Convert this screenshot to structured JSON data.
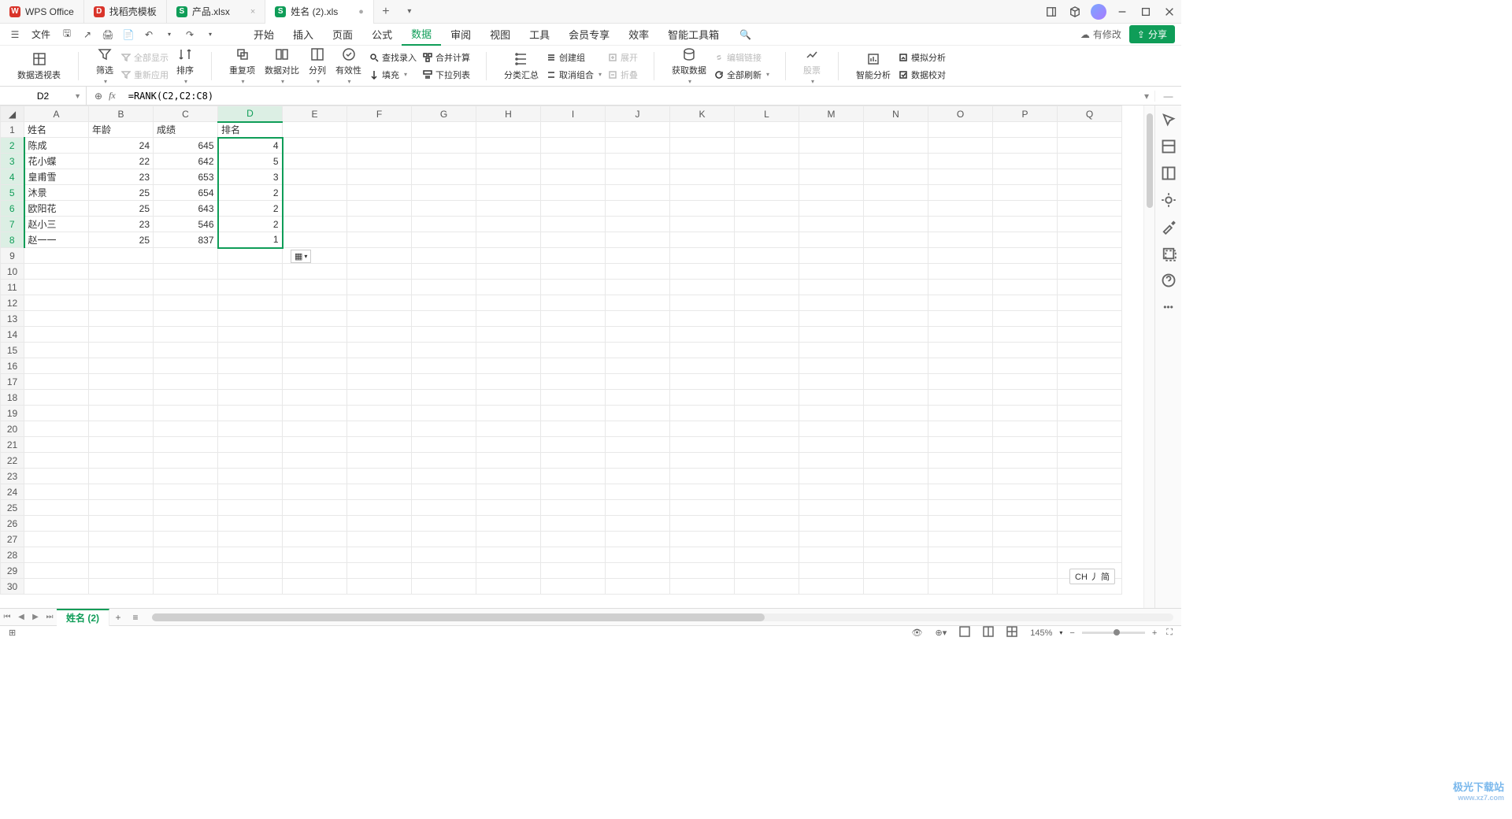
{
  "tabs": [
    {
      "badge": "W",
      "badge_class": "w",
      "label": "WPS Office",
      "active": false
    },
    {
      "badge": "D",
      "badge_class": "d",
      "label": "找稻壳模板",
      "active": false
    },
    {
      "badge": "S",
      "badge_class": "s",
      "label": "产品.xlsx",
      "active": false,
      "close_hint": ""
    },
    {
      "badge": "S",
      "badge_class": "s",
      "label": "姓名 (2).xls",
      "active": true,
      "close_hint": "●"
    }
  ],
  "menu": {
    "file": "文件",
    "items": [
      "开始",
      "插入",
      "页面",
      "公式",
      "数据",
      "审阅",
      "视图",
      "工具",
      "会员专享",
      "效率",
      "智能工具箱"
    ],
    "active_index": 4,
    "modify_label": "有修改",
    "share": "分享"
  },
  "ribbon": {
    "pivot": "数据透视表",
    "filter": "筛选",
    "show_all": "全部显示",
    "reapply": "重新应用",
    "sort": "排序",
    "dup": "重复项",
    "compare": "数据对比",
    "split": "分列",
    "validate": "有效性",
    "lookup": "查找录入",
    "consolidate": "合并计算",
    "fill": "填充",
    "dropdown_list": "下拉列表",
    "subtotal": "分类汇总",
    "group": "创建组",
    "ungroup": "取消组合",
    "expand": "展开",
    "collapse": "折叠",
    "get_data": "获取数据",
    "edit_link": "编辑链接",
    "refresh_all": "全部刷新",
    "stock": "股票",
    "smart": "智能分析",
    "simulate": "模拟分析",
    "validate2": "数据校对"
  },
  "namebox": "D2",
  "formula": "=RANK(C2,C2:C8)",
  "columns": [
    "A",
    "B",
    "C",
    "D",
    "E",
    "F",
    "G",
    "H",
    "I",
    "J",
    "K",
    "L",
    "M",
    "N",
    "O",
    "P",
    "Q"
  ],
  "row_count": 30,
  "headers": [
    "姓名",
    "年龄",
    "成绩",
    "排名"
  ],
  "rows": [
    {
      "a": "陈成",
      "b": "24",
      "c": "645",
      "d": "4"
    },
    {
      "a": "花小蝶",
      "b": "22",
      "c": "642",
      "d": "5"
    },
    {
      "a": "皇甫雪",
      "b": "23",
      "c": "653",
      "d": "3"
    },
    {
      "a": "沐景",
      "b": "25",
      "c": "654",
      "d": "2"
    },
    {
      "a": "欧阳花",
      "b": "25",
      "c": "643",
      "d": "2"
    },
    {
      "a": "赵小三",
      "b": "23",
      "c": "546",
      "d": "2"
    },
    {
      "a": "赵一一",
      "b": "25",
      "c": "837",
      "d": "1"
    }
  ],
  "selection": {
    "col": "D",
    "row_start": 2,
    "row_end": 8
  },
  "sheet_tab": "姓名 (2)",
  "ime_badge": "CH 丿 简",
  "status": {
    "zoom": "145%"
  },
  "watermark": {
    "main": "极光下载站",
    "sub": "www.xz7.com"
  }
}
